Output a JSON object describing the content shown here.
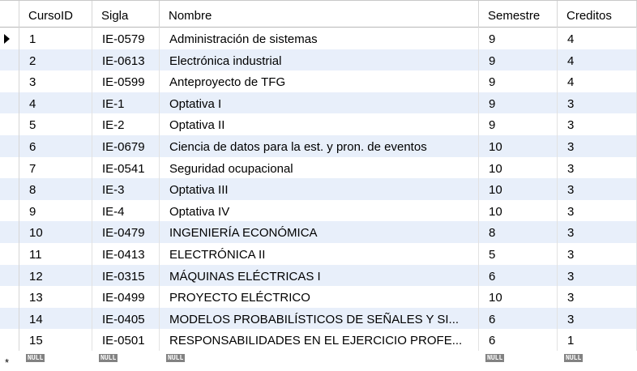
{
  "columns": [
    "CursoID",
    "Sigla",
    "Nombre",
    "Semestre",
    "Creditos"
  ],
  "rows": [
    [
      "1",
      "IE-0579",
      "Administración de sistemas",
      "9",
      "4"
    ],
    [
      "2",
      "IE-0613",
      "Electrónica industrial",
      "9",
      "4"
    ],
    [
      "3",
      "IE-0599",
      "Anteproyecto de TFG",
      "9",
      "4"
    ],
    [
      "4",
      "IE-1",
      "Optativa I",
      "9",
      "3"
    ],
    [
      "5",
      "IE-2",
      "Optativa II",
      "9",
      "3"
    ],
    [
      "6",
      "IE-0679",
      "Ciencia de datos para la est. y pron. de eventos",
      "10",
      "3"
    ],
    [
      "7",
      "IE-0541",
      "Seguridad ocupacional",
      "10",
      "3"
    ],
    [
      "8",
      "IE-3",
      "Optativa III",
      "10",
      "3"
    ],
    [
      "9",
      "IE-4",
      "Optativa IV",
      "10",
      "3"
    ],
    [
      "10",
      "IE-0479",
      "INGENIERÍA ECONÓMICA",
      "8",
      "3"
    ],
    [
      "11",
      "IE-0413",
      "ELECTRÓNICA II",
      "5",
      "3"
    ],
    [
      "12",
      "IE-0315",
      "MÁQUINAS ELÉCTRICAS I",
      "6",
      "3"
    ],
    [
      "13",
      "IE-0499",
      "PROYECTO ELÉCTRICO",
      "10",
      "3"
    ],
    [
      "14",
      "IE-0405",
      "MODELOS PROBABILÍSTICOS DE SEÑALES Y SI...",
      "6",
      "3"
    ],
    [
      "15",
      "IE-0501",
      "RESPONSABILIDADES EN EL EJERCICIO PROFE...",
      "6",
      "1"
    ]
  ],
  "new_row": {
    "marker": "*",
    "null_label": "NULL"
  },
  "current_row_icon": "current-row-arrow-icon",
  "colors": {
    "alt_row": "#e8effa",
    "null_badge": "#828282"
  }
}
